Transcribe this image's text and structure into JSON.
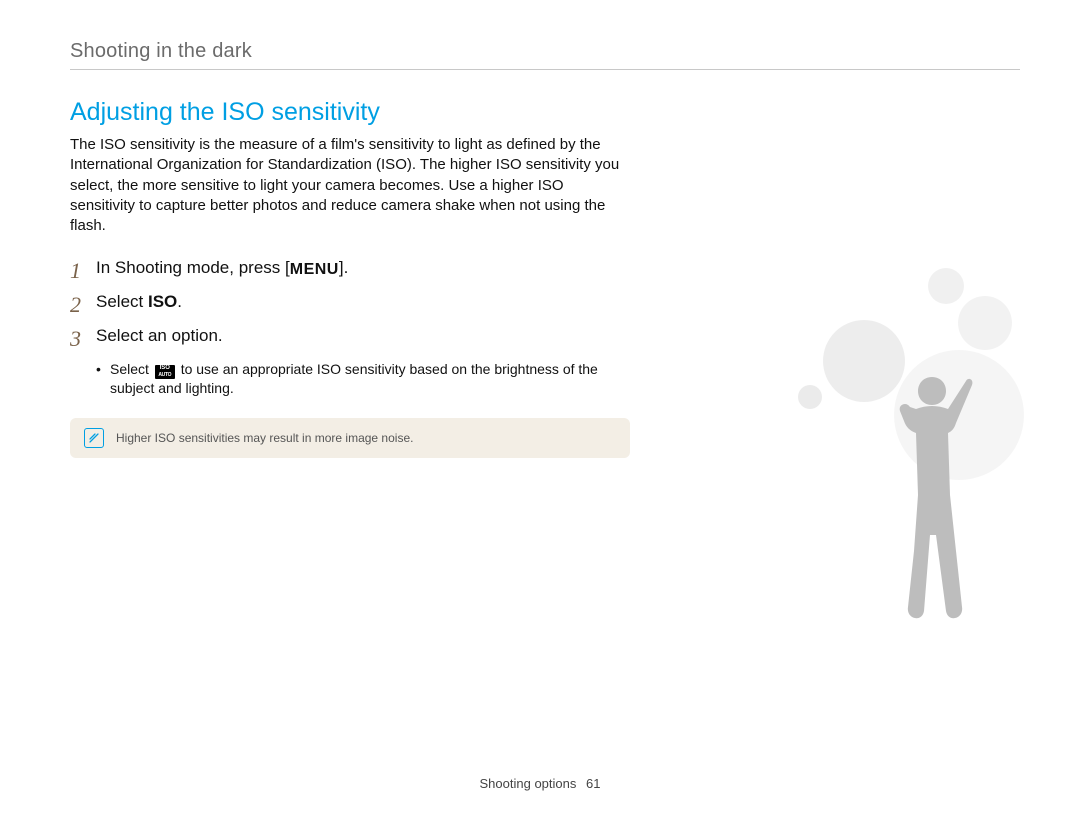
{
  "breadcrumb": "Shooting in the dark",
  "heading": "Adjusting the ISO sensitivity",
  "intro": "The ISO sensitivity is the measure of a film's sensitivity to light as defined by the International Organization for Standardization (ISO). The higher ISO sensitivity you select, the more sensitive to light your camera becomes. Use a higher ISO sensitivity to capture better photos and reduce camera shake when not using the flash.",
  "steps": [
    {
      "num": "1",
      "pre": "In Shooting mode, press [",
      "btn": "MENU",
      "post": "]."
    },
    {
      "num": "2",
      "pre": "Select ",
      "strong": "ISO",
      "post": "."
    },
    {
      "num": "3",
      "pre": "Select an option.",
      "post": ""
    }
  ],
  "sub": {
    "pre": "Select ",
    "icon": {
      "top": "ISO",
      "bot": "AUTO"
    },
    "post": " to use an appropriate ISO sensitivity based on the brightness of the subject and lighting."
  },
  "note": "Higher ISO sensitivities may result in more image noise.",
  "footer": {
    "section": "Shooting options",
    "page": "61"
  }
}
